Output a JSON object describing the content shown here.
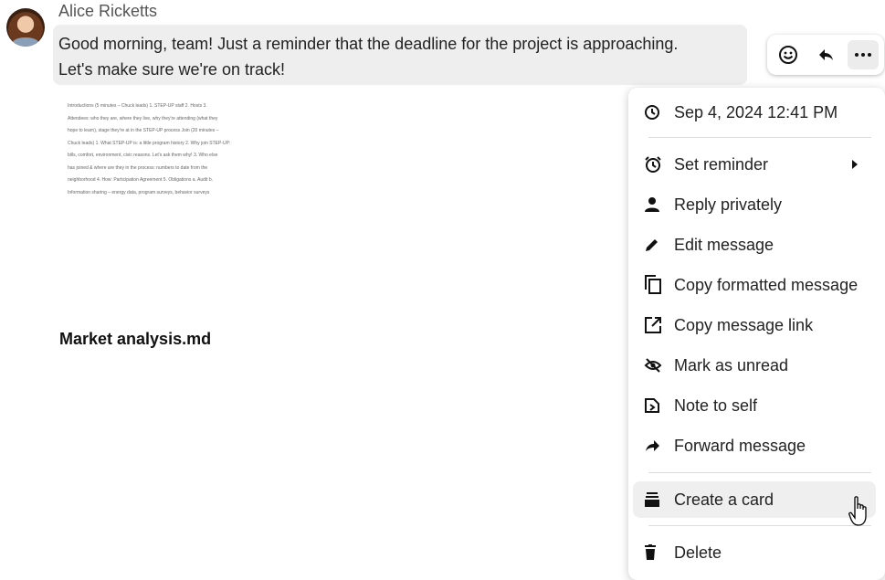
{
  "message": {
    "author": "Alice Ricketts",
    "text_line1": "Good morning, team! Just a reminder that the deadline for the project is approaching.",
    "text_line2": "Let's make sure we're on track!",
    "doc_preview_lines": [
      "Introductions (5 minutes – Chuck leads) 1. STEP-UP staff 2. Hosts 3.",
      "Attendees: who they are, where they live, why they're attending (what they",
      "hope to learn), stage they're at in the STEP-UP process Join (20 minutes –",
      "Chuck leads) 1. What STEP-UP is: a little program history 2. Why join STEP-UP:",
      "bills, comfort, environment, civic reasons. Let's ask them why! 3. Who else",
      "has joined & where are they in the process: numbers to date from the",
      "neighborhood 4. How: Participation Agreement 5. Obligations a. Audit b.",
      "Information sharing – energy data, program surveys, behavior surveys"
    ],
    "attachment_name": "Market analysis.md"
  },
  "actions": {
    "react_icon": "smiley-icon",
    "reply_icon": "reply-icon",
    "more_icon": "more-icon"
  },
  "menu": {
    "timestamp": "Sep 4, 2024 12:41 PM",
    "items": [
      {
        "label": "Set reminder",
        "icon": "alarm-icon",
        "submenu": true
      },
      {
        "label": "Reply privately",
        "icon": "person-icon"
      },
      {
        "label": "Edit message",
        "icon": "pencil-icon"
      },
      {
        "label": "Copy formatted message",
        "icon": "copy-icon"
      },
      {
        "label": "Copy message link",
        "icon": "external-link-icon"
      },
      {
        "label": "Mark as unread",
        "icon": "eye-off-icon"
      },
      {
        "label": "Note to self",
        "icon": "note-icon"
      },
      {
        "label": "Forward message",
        "icon": "forward-icon"
      },
      {
        "label": "Create a card",
        "icon": "card-stack-icon"
      },
      {
        "label": "Delete",
        "icon": "trash-icon"
      }
    ]
  },
  "colors": {
    "bubble": "#eeeeee",
    "hover": "#efefef",
    "text": "#222222"
  }
}
